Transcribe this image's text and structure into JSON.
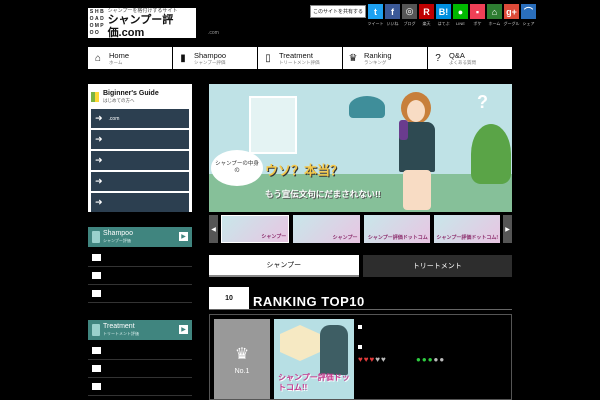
{
  "header": {
    "logo_grid": [
      "S",
      "H",
      "B",
      "O",
      "A",
      "D",
      "O",
      "M",
      "P",
      "O",
      "O",
      ""
    ],
    "logo_tagline": "シャンプーを格付けするサイト",
    "logo_title": "シャンプー評価.com",
    "lang_text": ".com",
    "share_label": "このサイトを共有する",
    "social": [
      {
        "glyph": "t",
        "label": "ツイート",
        "color": "#1da1f2",
        "icon": "twitter-icon"
      },
      {
        "glyph": "f",
        "label": "いいね",
        "color": "#3b5998",
        "icon": "facebook-icon"
      },
      {
        "glyph": "◎",
        "label": "ブログ",
        "color": "#555555",
        "icon": "blog-icon"
      },
      {
        "glyph": "R",
        "label": "楽天",
        "color": "#bf0000",
        "icon": "rakuten-icon"
      },
      {
        "glyph": "B!",
        "label": "はてぶ",
        "color": "#008fde",
        "icon": "hatena-icon"
      },
      {
        "glyph": "●",
        "label": "LINE",
        "color": "#00b900",
        "icon": "line-icon"
      },
      {
        "glyph": "▪",
        "label": "ポケ",
        "color": "#ef4056",
        "icon": "pocket-icon"
      },
      {
        "glyph": "⌂",
        "label": "ホーム",
        "color": "#2e7d32",
        "icon": "home-icon"
      },
      {
        "glyph": "g+",
        "label": "グーグル",
        "color": "#dd4b39",
        "icon": "googleplus-icon"
      },
      {
        "glyph": "⌒",
        "label": "シェア",
        "color": "#2a6ebb",
        "icon": "share-icon"
      }
    ]
  },
  "nav": [
    {
      "en": "Home",
      "jp": "ホーム",
      "icon": "house-icon",
      "glyph": "⌂"
    },
    {
      "en": "Shampoo",
      "jp": "シャンプー評価",
      "icon": "bottle-icon",
      "glyph": "▮"
    },
    {
      "en": "Treatment",
      "jp": "トリートメント評価",
      "icon": "tube-icon",
      "glyph": "▯"
    },
    {
      "en": "Ranking",
      "jp": "ランキング",
      "icon": "crown-icon",
      "glyph": "♛"
    },
    {
      "en": "Q&A",
      "jp": "よくある質問",
      "icon": "question-icon",
      "glyph": "?"
    }
  ],
  "sidebar": {
    "guide_title": "Biginner's Guide",
    "guide_sub": "はじめての方へ",
    "guide_items": [
      ".com",
      "",
      "",
      "",
      ""
    ],
    "shampoo": {
      "en": "Shampoo",
      "jp": "シャンプー評価"
    },
    "treatment": {
      "en": "Treatment",
      "jp": "トリートメント評価"
    }
  },
  "hero": {
    "speech": "シャンプーの中身の",
    "catch1": "ウソ？本当？",
    "catch2": "もう宣伝文句にだまされない!!",
    "qmark": "?"
  },
  "thumbs": [
    "シャンプー",
    "シャンプー",
    "シャンプー評価ドットコム",
    "シャンプー評価ドットコム!"
  ],
  "tabs": {
    "shampoo": "シャンプー",
    "treatment": "トリートメント"
  },
  "ranking": {
    "crown_num": "10",
    "title": "RANKING TOP10",
    "no1_label": "No.1",
    "product_text": "シャンプー評価ドットコム!!",
    "ratings": [
      {
        "color": "#e23b3b",
        "filled": 3,
        "total": 5,
        "labels": [
          "",
          "",
          "",
          "",
          ""
        ]
      },
      {
        "color": "#2ecc40",
        "filled": 3,
        "total": 5,
        "labels": [
          "",
          "",
          "",
          "",
          ""
        ]
      }
    ]
  }
}
